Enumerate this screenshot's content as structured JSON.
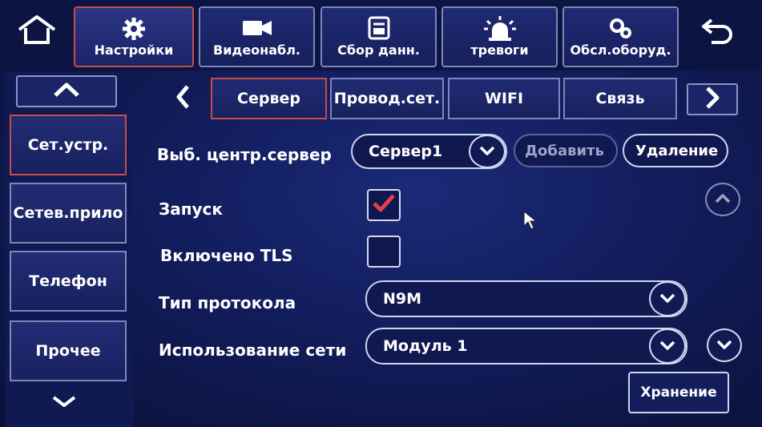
{
  "top_nav": {
    "items": [
      {
        "label": "Настройки",
        "icon": "gear-icon"
      },
      {
        "label": "Видеонабл.",
        "icon": "video-camera-icon"
      },
      {
        "label": "Сбор данн.",
        "icon": "data-collection-icon"
      },
      {
        "label": "тревоги",
        "icon": "alarm-light-icon"
      },
      {
        "label": "Обсл.оборуд.",
        "icon": "maintenance-gear-icon"
      }
    ]
  },
  "sidebar": {
    "items": [
      {
        "label": "Сет.устр."
      },
      {
        "label": "Сетев.прило"
      },
      {
        "label": "Телефон"
      },
      {
        "label": "Прочее"
      }
    ]
  },
  "tabs": {
    "items": [
      {
        "label": "Сервер"
      },
      {
        "label": "Провод.сет."
      },
      {
        "label": "WIFI"
      },
      {
        "label": "Связь"
      }
    ]
  },
  "form": {
    "center_server_label": "Выб. центр.сервер",
    "center_server_value": "Сервер1",
    "add_label": "Добавить",
    "delete_label": "Удаление",
    "launch_label": "Запуск",
    "launch_checked": true,
    "tls_label": "Включено TLS",
    "tls_checked": false,
    "protocol_label": "Тип протокола",
    "protocol_value": "N9M",
    "network_label": "Использование сети",
    "network_value": "Модуль 1",
    "save_label": "Хранение"
  },
  "colors": {
    "active_border": "#c94a4a",
    "background": "#111c5a",
    "checkmark": "#e0404a"
  }
}
